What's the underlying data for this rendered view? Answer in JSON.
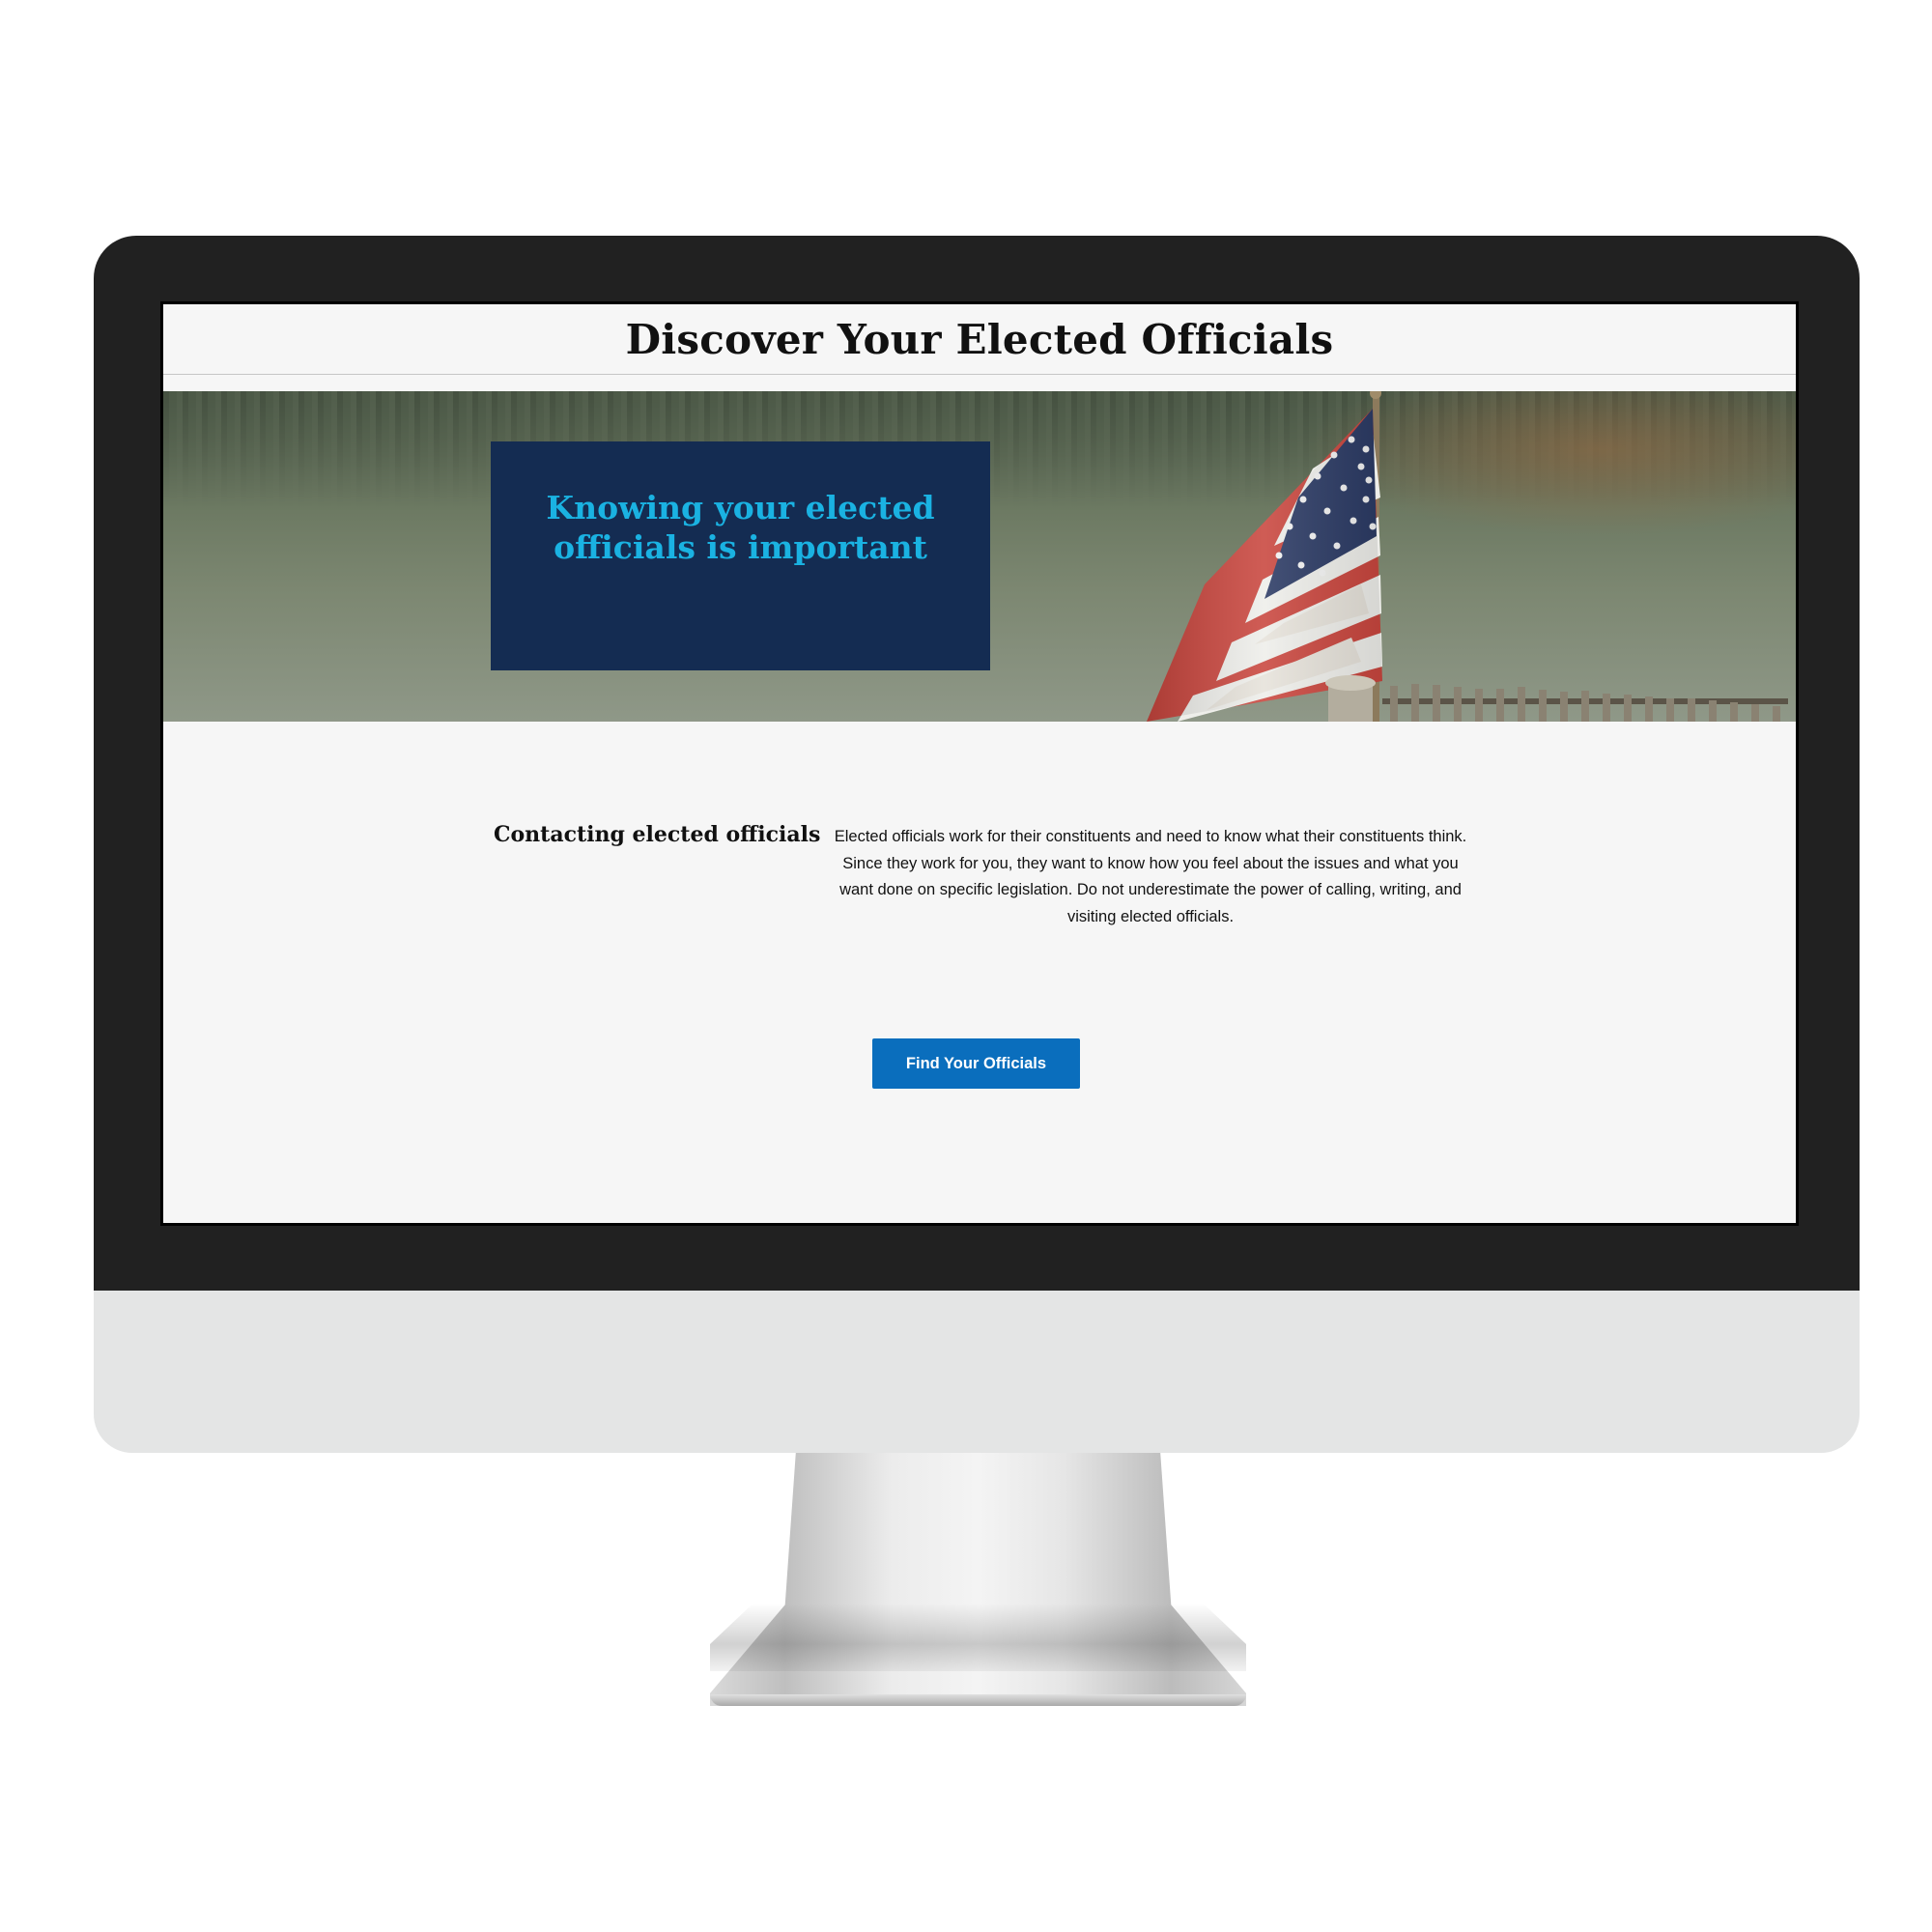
{
  "page": {
    "title": "Discover Your Elected Officials"
  },
  "hero": {
    "headline": "Knowing your elected officials is important",
    "image_subject": "american-flag-photo"
  },
  "content": {
    "heading": "Contacting elected officials",
    "body": "Elected officials work for their constituents and need to know what their constituents think. Since they work for you, they want to know how you feel about the issues and what you want done on specific legislation. Do not underestimate the power of calling, writing, and visiting elected officials."
  },
  "cta": {
    "label": "Find Your Officials"
  },
  "colors": {
    "hero_card": "#142c52",
    "hero_headline": "#1ab2e2",
    "button": "#0a6ebd",
    "screen_background": "#f6f6f6",
    "bezel": "#212121"
  }
}
